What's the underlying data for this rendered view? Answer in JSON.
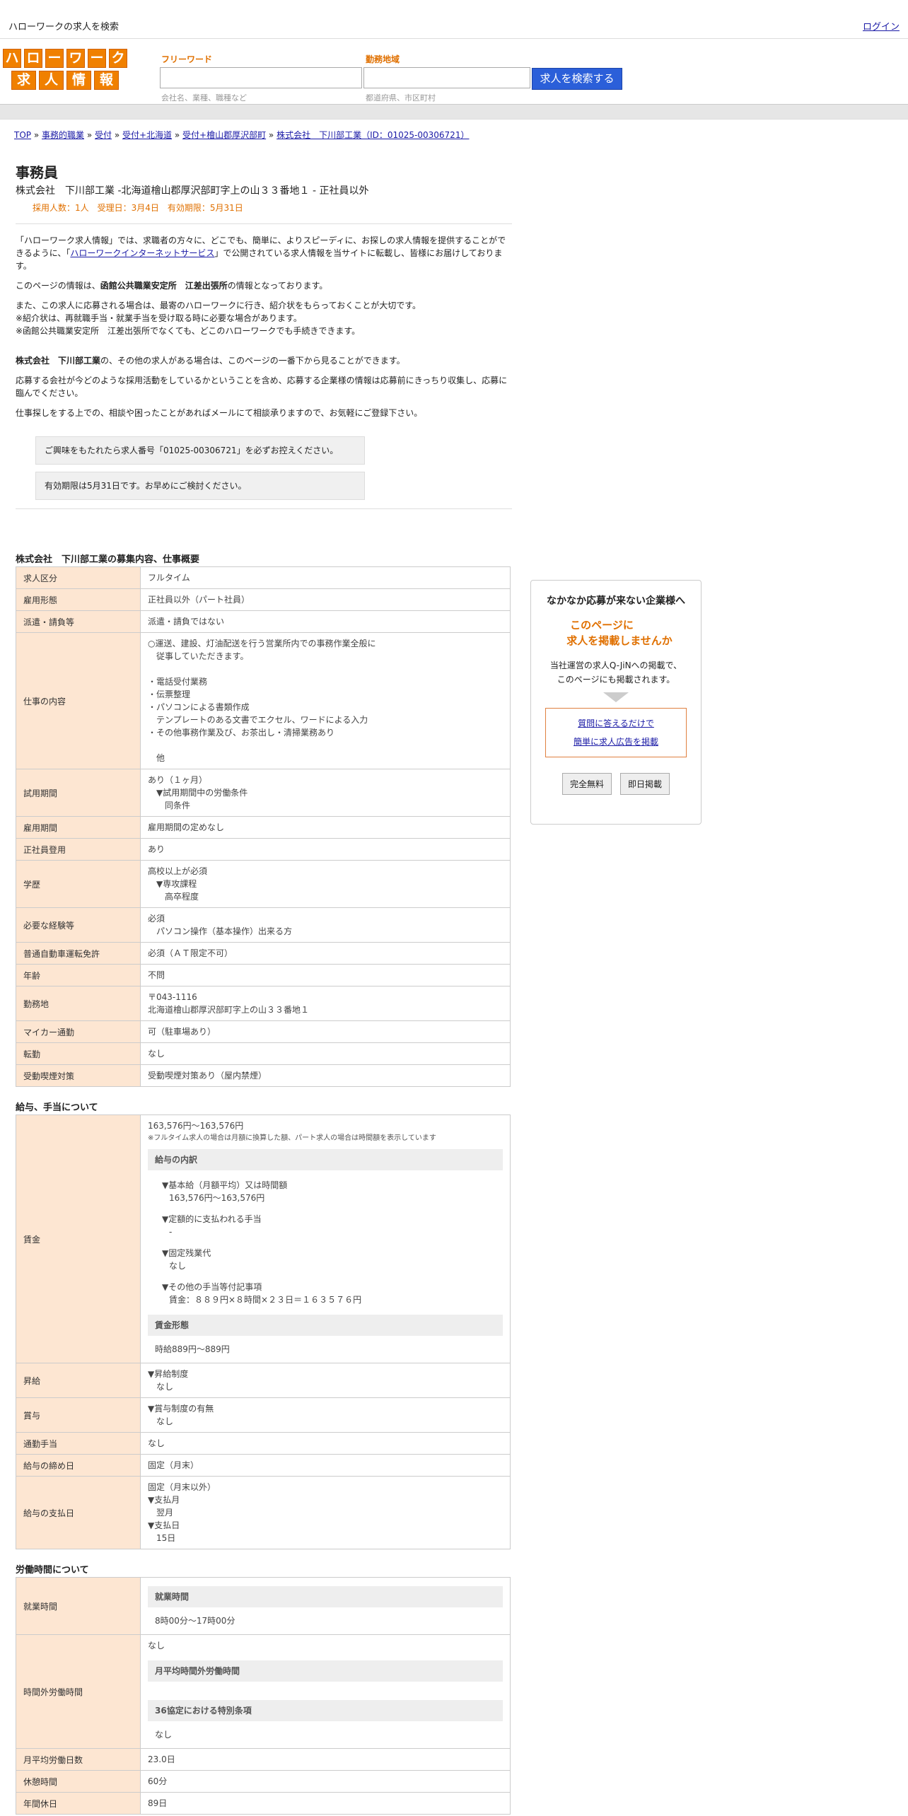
{
  "header": {
    "site_title": "ハローワークの求人を検索",
    "login": "ログイン",
    "logo_row1": [
      "ハ",
      "ロ",
      "ー",
      "ワ",
      "ー",
      "ク"
    ],
    "logo_row2": [
      "求",
      "人",
      "情",
      "報"
    ],
    "freeword_label": "フリーワード",
    "freeword_hint": "会社名、業種、職種など",
    "area_label": "勤務地域",
    "area_hint": "都道府県、市区町村",
    "search_button": "求人を検索する"
  },
  "breadcrumb": [
    "TOP",
    "事務的職業",
    "受付",
    "受付+北海道",
    "受付+檜山郡厚沢部町",
    "株式会社　下川部工業（ID：01025-00306721）"
  ],
  "job": {
    "title": "事務員",
    "subtitle": "株式会社　下川部工業 -北海道檜山郡厚沢部町字上の山３３番地１ - 正社員以外",
    "meta": "採用人数：1人　受理日：3月4日　有効期限：5月31日"
  },
  "intro": {
    "p1a": "「ハローワーク求人情報」では、求職者の方々に、どこでも、簡単に、よりスピーディに、お探しの求人情報を提供することができるように、「",
    "p1link": "ハローワークインターネットサービス",
    "p1b": "」で公開されている求人情報を当サイトに転載し、皆様にお届けしております。",
    "p2a": "このページの情報は、",
    "p2b": "函館公共職業安定所　江差出張所",
    "p2c": "の情報となっております。",
    "p3": "また、この求人に応募される場合は、最寄のハローワークに行き、紹介状をもらっておくことが大切です。",
    "p4": "※紹介状は、再就職手当・就業手当を受け取る時に必要な場合があります。",
    "p5": "※函館公共職業安定所　江差出張所でなくても、どこのハローワークでも手続きできます。",
    "p6a": "株式会社　下川部工業",
    "p6b": "の、その他の求人がある場合は、このページの一番下から見ることができます。",
    "p7": "応募する会社が今どのような採用活動をしているかということを含め、応募する企業様の情報は応募前にきっちり収集し、応募に臨んでください。",
    "p8": "仕事探しをする上での、相談や困ったことがあればメールにて相談承りますので、お気軽にご登録下さい。",
    "notice1": "ご興味をもたれたら求人番号「01025-00306721」を必ずお控えください。",
    "notice2": "有効期限は5月31日です。お早めにご検討ください。"
  },
  "section1": {
    "title": "株式会社　下川部工業の募集内容、仕事概要",
    "rows": [
      {
        "k": "求人区分",
        "v": [
          "フルタイム"
        ]
      },
      {
        "k": "雇用形態",
        "v": [
          "正社員以外（パート社員）"
        ]
      },
      {
        "k": "派遣・請負等",
        "v": [
          "派遣・請負ではない"
        ]
      },
      {
        "k": "仕事の内容",
        "v": [
          "○運送、建設、灯油配送を行う営業所内での事務作業全般に",
          "　従事していただきます。",
          " ",
          "・電話受付業務",
          "・伝票整理",
          "・パソコンによる書類作成",
          "　テンプレートのある文書でエクセル、ワードによる入力",
          "・その他事務作業及び、お茶出し・清掃業務あり",
          " ",
          "　他"
        ]
      },
      {
        "k": "試用期間",
        "v": [
          "あり（１ヶ月）",
          "　▼試用期間中の労働条件",
          "　　同条件"
        ]
      },
      {
        "k": "雇用期間",
        "v": [
          "雇用期間の定めなし"
        ]
      },
      {
        "k": "正社員登用",
        "v": [
          "あり"
        ]
      },
      {
        "k": "学歴",
        "v": [
          "高校以上が必須",
          "　▼専攻課程",
          "　　高卒程度"
        ]
      },
      {
        "k": "必要な経験等",
        "v": [
          "必須",
          "　パソコン操作（基本操作）出来る方"
        ]
      },
      {
        "k": "普通自動車運転免許",
        "v": [
          "必須（ＡＴ限定不可）"
        ]
      },
      {
        "k": "年齢",
        "v": [
          "不問"
        ]
      },
      {
        "k": "勤務地",
        "v": [
          "〒043-1116",
          "北海道檜山郡厚沢部町字上の山３３番地１"
        ]
      },
      {
        "k": "マイカー通勤",
        "v": [
          "可（駐車場あり）"
        ]
      },
      {
        "k": "転勤",
        "v": [
          "なし"
        ]
      },
      {
        "k": "受動喫煙対策",
        "v": [
          "受動喫煙対策あり（屋内禁煙）"
        ]
      }
    ]
  },
  "section2": {
    "title": "給与、手当について",
    "wage_label": "賃金",
    "wage_range": "163,576円〜163,576円",
    "wage_note": "※フルタイム求人の場合は月額に換算した額、パート求人の場合は時間額を表示しています",
    "breakdown_head": "給与の内訳",
    "b1": "▼基本給（月額平均）又は時間額",
    "b1v": "163,576円〜163,576円",
    "b2": "▼定額的に支払われる手当",
    "b2v": "-",
    "b3": "▼固定残業代",
    "b3v": "なし",
    "b4": "▼その他の手当等付記事項",
    "b4v": "賃金：８８９円×８時間×２３日＝１６３５７６円",
    "form_head": "賃金形態",
    "form_v": "時給889円〜889円",
    "raise_k": "昇給",
    "raise_v": [
      "▼昇給制度",
      "　なし"
    ],
    "bonus_k": "賞与",
    "bonus_v": [
      "▼賞与制度の有無",
      "　なし"
    ],
    "commute_k": "通勤手当",
    "commute_v": "なし",
    "close_k": "給与の締め日",
    "close_v": "固定（月末）",
    "pay_k": "給与の支払日",
    "pay_v": [
      "固定（月末以外）",
      "▼支払月",
      "　翌月",
      " ",
      "▼支払日",
      "　15日"
    ]
  },
  "section3": {
    "title": "労働時間について",
    "hours_k": "就業時間",
    "hours_head": "就業時間",
    "hours_v": "8時00分〜17時00分",
    "ot_k": "時間外労働時間",
    "ot_v": "なし",
    "ot_head1": "月平均時間外労働時間",
    "ot_head2": "36協定における特別条項",
    "ot_v2": "なし",
    "days_k": "月平均労働日数",
    "days_v": "23.0日",
    "break_k": "休憩時間",
    "break_v": "60分",
    "holiday_k": "年間休日",
    "holiday_v": "89日"
  },
  "side": {
    "heading": "なかなか応募が来ない企業様へ",
    "promo1": "このページに",
    "promo2": "求人を掲載しませんか",
    "desc1": "当社運営の求人Q-JiNへの掲載で、",
    "desc2": "このページにも掲載されます。",
    "link1": "質問に答えるだけで",
    "link2": "簡単に求人広告を掲載",
    "btn1": "完全無料",
    "btn2": "即日掲載"
  }
}
